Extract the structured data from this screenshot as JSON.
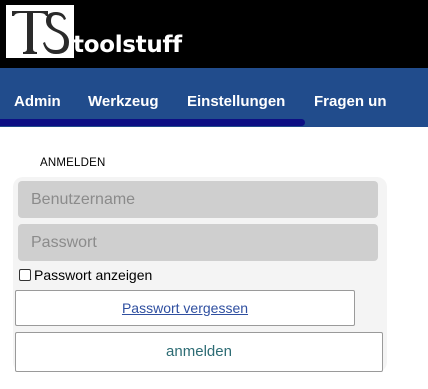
{
  "header": {
    "logo_alt": "TS",
    "brand": "toolstuff"
  },
  "nav": {
    "items": [
      "Admin",
      "Werkzeug",
      "Einstellungen",
      "Fragen un"
    ]
  },
  "login": {
    "title": "ANMELDEN",
    "username_placeholder": "Benutzername",
    "password_placeholder": "Passwort",
    "show_password_label": "Passwort anzeigen",
    "show_password_checked": false,
    "forgot_label": "Passwort vergessen",
    "submit_label": "anmelden"
  },
  "colors": {
    "header_bg": "#000000",
    "nav_bg": "#214c8c",
    "nav_active_underline": "#0d0f84",
    "field_bg": "#cfcfcf",
    "link": "#2f4fa0",
    "submit_text": "#2d6c74"
  }
}
